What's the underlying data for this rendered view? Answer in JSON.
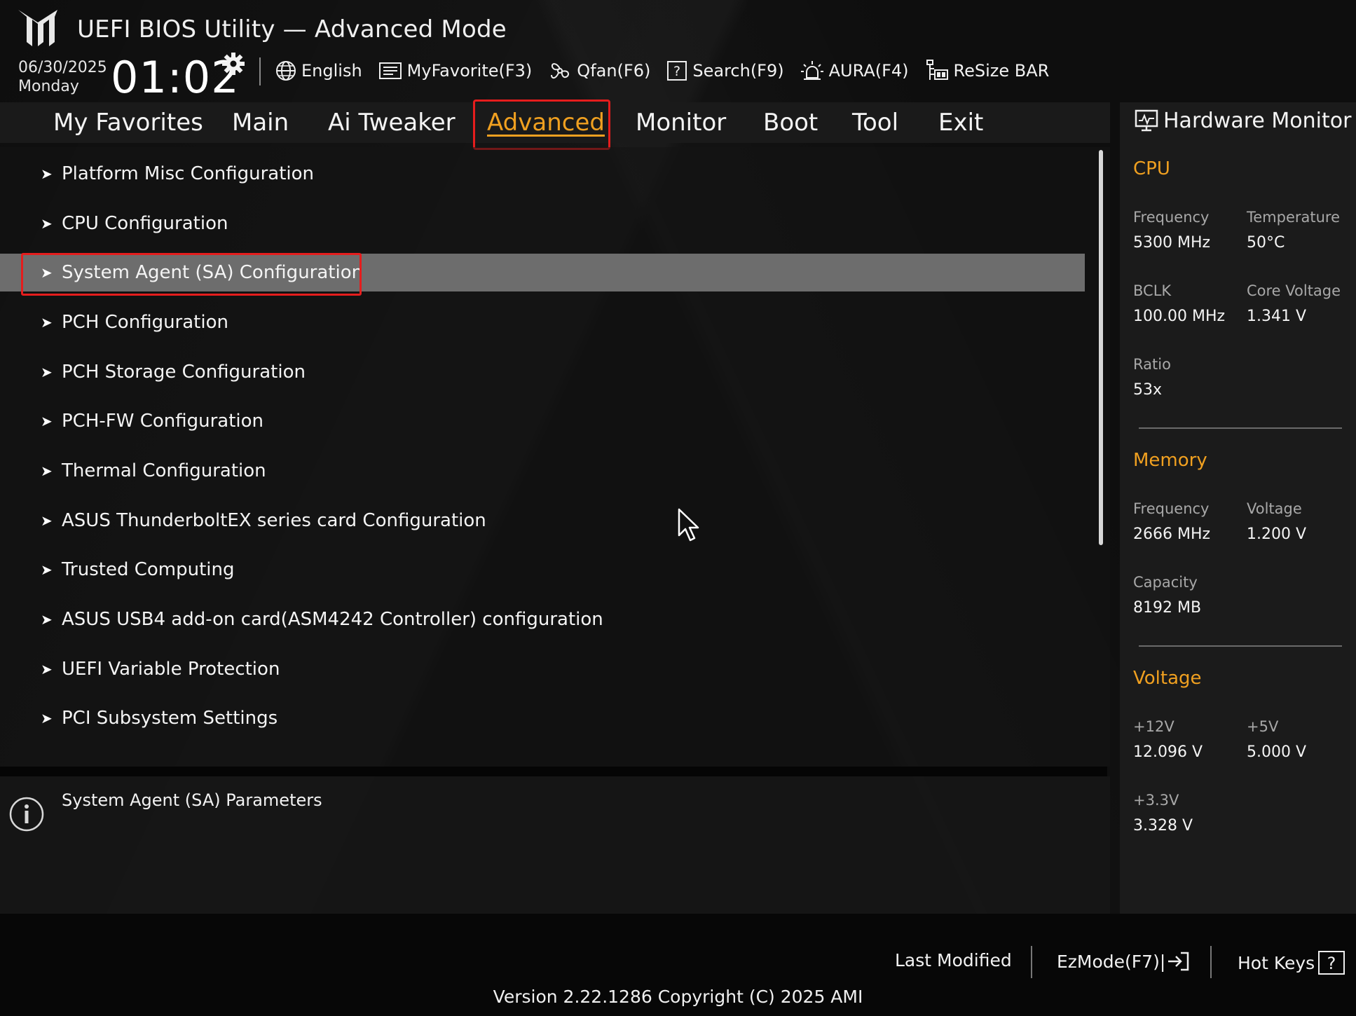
{
  "header": {
    "title": "UEFI BIOS Utility — Advanced Mode",
    "date": "06/30/2025",
    "day": "Monday",
    "time": "01:02",
    "toolbar": [
      {
        "label": "English",
        "icon": "globe-icon"
      },
      {
        "label": "MyFavorite(F3)",
        "icon": "favorite-list-icon"
      },
      {
        "label": "Qfan(F6)",
        "icon": "fan-icon"
      },
      {
        "label": "Search(F9)",
        "icon": "search-help-icon"
      },
      {
        "label": "AURA(F4)",
        "icon": "aura-light-icon"
      },
      {
        "label": "ReSize BAR",
        "icon": "resize-bar-icon"
      }
    ]
  },
  "tabs": [
    "My Favorites",
    "Main",
    "Ai Tweaker",
    "Advanced",
    "Monitor",
    "Boot",
    "Tool",
    "Exit"
  ],
  "active_tab": "Advanced",
  "menu": [
    "Platform Misc Configuration",
    "CPU Configuration",
    "System Agent (SA) Configuration",
    "PCH Configuration",
    "PCH Storage Configuration",
    "PCH-FW Configuration",
    "Thermal Configuration",
    "ASUS ThunderboltEX series card Configuration",
    "Trusted Computing",
    "ASUS USB4 add-on card(ASM4242 Controller) configuration",
    "UEFI Variable Protection",
    "PCI Subsystem Settings"
  ],
  "selected_item": "System Agent (SA) Configuration",
  "help": {
    "text": "System Agent (SA) Parameters"
  },
  "hardware_monitor": {
    "title": "Hardware Monitor",
    "cpu": {
      "heading": "CPU",
      "frequency_label": "Frequency",
      "frequency": "5300 MHz",
      "temperature_label": "Temperature",
      "temperature": "50°C",
      "bclk_label": "BCLK",
      "bclk": "100.00 MHz",
      "core_voltage_label": "Core Voltage",
      "core_voltage": "1.341 V",
      "ratio_label": "Ratio",
      "ratio": "53x"
    },
    "memory": {
      "heading": "Memory",
      "frequency_label": "Frequency",
      "frequency": "2666 MHz",
      "voltage_label": "Voltage",
      "voltage": "1.200 V",
      "capacity_label": "Capacity",
      "capacity": "8192 MB"
    },
    "voltage": {
      "heading": "Voltage",
      "v12_label": "+12V",
      "v12": "12.096 V",
      "v5_label": "+5V",
      "v5": "5.000 V",
      "v33_label": "+3.3V",
      "v33": "3.328 V"
    }
  },
  "footer": {
    "last_modified": "Last Modified",
    "ezmode": "EzMode(F7)|",
    "hot_keys": "Hot Keys",
    "version": "Version 2.22.1286 Copyright (C) 2025 AMI"
  },
  "colors": {
    "accent": "#f0a020",
    "highlight": "#e51d1d",
    "selected_row": "#6d6d6d"
  }
}
